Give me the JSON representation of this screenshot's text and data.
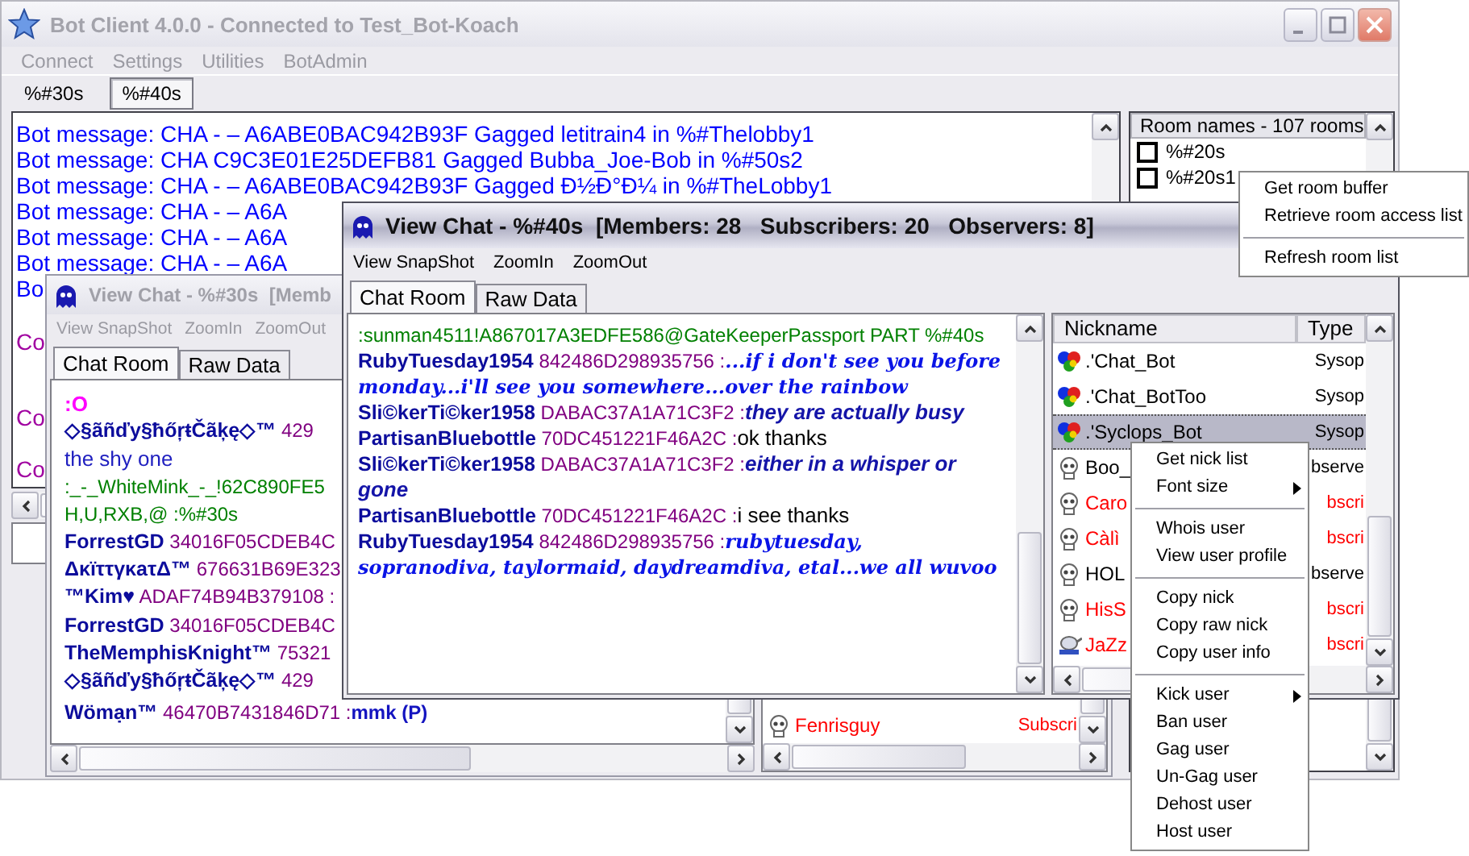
{
  "main_window": {
    "title": "Bot Client 4.0.0 - Connected to Test_Bot-Koach",
    "menu": [
      "Connect",
      "Settings",
      "Utilities",
      "BotAdmin"
    ],
    "tabs": [
      {
        "label": "%#30s",
        "selected": false
      },
      {
        "label": "%#40s",
        "selected": true
      }
    ],
    "log": [
      {
        "kind": "bot",
        "text": "Bot message:  CHA - – A6ABE0BAC942B93F Gagged letitrain4 in %#Thelobby1"
      },
      {
        "kind": "bot",
        "text": "Bot message:  CHA C9C3E01E25DEFB81 Gagged Bubba_Joe-Bob in %#50s2"
      },
      {
        "kind": "bot",
        "text": "Bot message:  CHA - – A6ABE0BAC942B93F Gagged Đ½Đ°Đ¼ in %#TheLobby1"
      },
      {
        "kind": "bot",
        "text": "Bot message:  CHA - – A6A"
      },
      {
        "kind": "bot",
        "text": "Bot message:  CHA - – A6A"
      },
      {
        "kind": "bot",
        "text": "Bot message:  CHA - – A6A"
      },
      {
        "kind": "bot",
        "text": "Bo"
      },
      {
        "kind": "chat",
        "text": "Co"
      },
      {
        "kind": "chat",
        "text": "Co"
      },
      {
        "kind": "chat",
        "text": "Co"
      }
    ],
    "room_list": {
      "header": "Room names - 107 rooms",
      "rooms": [
        {
          "name": "%#20s",
          "checked": false
        },
        {
          "name": "%#20s1",
          "checked": false
        }
      ]
    }
  },
  "room_menu": [
    {
      "label": "Get room buffer",
      "separator_before": false
    },
    {
      "label": "Retrieve room access list",
      "separator_before": false
    },
    {
      "label": "Refresh room list",
      "separator_before": true
    }
  ],
  "chat_windows": [
    {
      "title": "View Chat - %#30s  [Memb",
      "active": false,
      "menu": [
        "View SnapShot",
        "ZoomIn",
        "ZoomOut"
      ],
      "tabs": [
        {
          "label": "Chat Room",
          "selected": true
        },
        {
          "label": "Raw Data",
          "selected": false
        }
      ],
      "lines": [
        {
          "kind": "emote",
          "text": ":O"
        },
        {
          "kind": "nick",
          "nick": "◇§ãñďy§ħőŗŧČãķę◇™",
          "id": "429"
        },
        {
          "kind": "plain",
          "text": "the shy one"
        },
        {
          "kind": "system",
          "text": ":_-_WhiteMink_-_!62C890FE5"
        },
        {
          "kind": "system",
          "text": "H,U,RXB,@ :%#30s"
        },
        {
          "kind": "nick",
          "nick": "ForrestGD",
          "id": "34016F05CDEB4C"
        },
        {
          "kind": "nick",
          "nick": "ΔκïττγκaτΔ™",
          "id": "676631B69E323"
        },
        {
          "kind": "nick",
          "nick": "™Kim♥",
          "id": "ADAF74B94B379108 :"
        },
        {
          "kind": "nick",
          "nick": "ForrestGD",
          "id": "34016F05CDEB4C"
        },
        {
          "kind": "nick",
          "nick": "TheMemphisKnight™",
          "id": "75321"
        },
        {
          "kind": "nick",
          "nick": "◇§ãñďy§ħőŗŧČãķę◇™",
          "id": "429"
        },
        {
          "kind": "strong",
          "nick": "Wömạn™",
          "id": "46470B7431846D71 :",
          "message": "mmk (P)"
        }
      ],
      "nick_list": {
        "rows": [
          {
            "kind": "user",
            "name": "Fenrisguy",
            "type": "Subscri",
            "color": "#ff0000",
            "selected": false
          }
        ]
      }
    },
    {
      "title": "View Chat - %#40s  [Members: 28   Subscribers: 20   Observers: 8]",
      "active": true,
      "menu": [
        "View SnapShot",
        "ZoomIn",
        "ZoomOut"
      ],
      "tabs": [
        {
          "label": "Chat Room",
          "selected": true
        },
        {
          "label": "Raw Data",
          "selected": false
        }
      ],
      "lines": [
        {
          "kind": "system",
          "text": ":sunman4511!A867017A3EDFE586@GateKeeperPassport PART %#40s"
        },
        {
          "kind": "fancy",
          "nick": "RubyTuesday1954",
          "id": "842486D298935756 :",
          "message": "...if i don't see you before monday...i'll see you somewhere...over the rainbow"
        },
        {
          "kind": "emphatic",
          "nick": "Sli©kerTi©ker1958",
          "id": "DABAC37A1A71C3F2 :",
          "message": "they are actually busy"
        },
        {
          "kind": "normal",
          "nick": "PartisanBluebottle",
          "id": "70DC451221F46A2C :",
          "message": "ok thanks"
        },
        {
          "kind": "emphatic",
          "nick": "Sli©kerTi©ker1958",
          "id": "DABAC37A1A71C3F2 :",
          "message": "either in a whisper or gone"
        },
        {
          "kind": "normal",
          "nick": "PartisanBluebottle",
          "id": "70DC451221F46A2C :",
          "message": "i see thanks"
        },
        {
          "kind": "fancy",
          "nick": "RubyTuesday1954",
          "id": "842486D298935756 :",
          "message": "rubytuesday, sopranodiva, taylormaid, daydreamdiva, etal...we all wuvoo"
        }
      ],
      "nick_list": {
        "columns": [
          "Nickname",
          "Type"
        ],
        "rows": [
          {
            "kind": "bot",
            "name": ".'Chat_Bot",
            "type": "Sysop",
            "color": "#000000",
            "selected": false
          },
          {
            "kind": "bot",
            "name": ".'Chat_BotToo",
            "type": "Sysop",
            "color": "#000000",
            "selected": false
          },
          {
            "kind": "bot",
            "name": ".'Syclops_Bot",
            "type": "Sysop",
            "color": "#000000",
            "selected": true
          },
          {
            "kind": "user",
            "name": "Boo_",
            "type": "bserve",
            "color": "#000000",
            "selected": false
          },
          {
            "kind": "user",
            "name": "Caro",
            "type": "bscri",
            "color": "#ff0000",
            "selected": false
          },
          {
            "kind": "user",
            "name": "Càlì",
            "type": "bscri",
            "color": "#ff0000",
            "selected": false
          },
          {
            "kind": "user",
            "name": "HOL",
            "type": "bserve",
            "color": "#000000",
            "selected": false
          },
          {
            "kind": "user",
            "name": "HisS",
            "type": "bscri",
            "color": "#ff0000",
            "selected": false
          },
          {
            "kind": "pc",
            "name": "JaZz",
            "type": "bscri",
            "color": "#ff0000",
            "selected": false
          }
        ]
      }
    }
  ],
  "nick_menu": [
    {
      "label": "Get nick list",
      "separator_before": false,
      "submenu": false
    },
    {
      "label": "Font size",
      "separator_before": false,
      "submenu": true
    },
    {
      "label": "Whois user",
      "separator_before": true,
      "submenu": false
    },
    {
      "label": "View user profile",
      "separator_before": false,
      "submenu": false
    },
    {
      "label": "Copy nick",
      "separator_before": true,
      "submenu": false
    },
    {
      "label": "Copy raw nick",
      "separator_before": false,
      "submenu": false
    },
    {
      "label": "Copy user info",
      "separator_before": false,
      "submenu": false
    },
    {
      "label": "Kick user",
      "separator_before": true,
      "submenu": true
    },
    {
      "label": "Ban user",
      "separator_before": false,
      "submenu": false
    },
    {
      "label": "Gag user",
      "separator_before": false,
      "submenu": false
    },
    {
      "label": "Un-Gag user",
      "separator_before": false,
      "submenu": false
    },
    {
      "label": "Dehost user",
      "separator_before": false,
      "submenu": false
    },
    {
      "label": "Host user",
      "separator_before": false,
      "submenu": false
    }
  ]
}
